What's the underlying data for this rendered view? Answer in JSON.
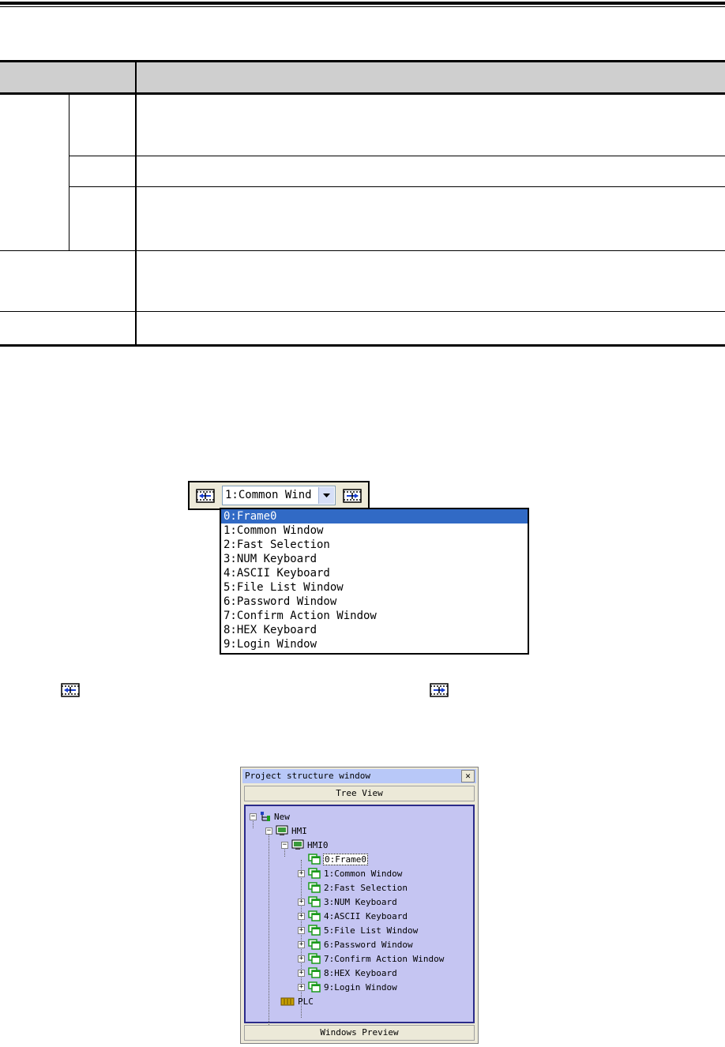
{
  "dropdown": {
    "selected": "1:Common Wind",
    "options": [
      "0:Frame0",
      "1:Common Window",
      "2:Fast Selection",
      "3:NUM Keyboard",
      "4:ASCII Keyboard",
      "5:File List Window",
      "6:Password Window",
      "7:Confirm Action Window",
      "8:HEX Keyboard",
      "9:Login Window"
    ],
    "prev_icon": "film-prev-icon",
    "next_icon": "film-next-icon"
  },
  "project_window": {
    "title": "Project structure window",
    "close": "✕",
    "tab_top": "Tree View",
    "tab_bottom": "Windows Preview",
    "tree": {
      "root": "New",
      "hmi": "HMI",
      "hmi0": "HMI0",
      "windows": [
        "0:Frame0",
        "1:Common Window",
        "2:Fast Selection",
        "3:NUM Keyboard",
        "4:ASCII Keyboard",
        "5:File List Window",
        "6:Password Window",
        "7:Confirm Action Window",
        "8:HEX Keyboard",
        "9:Login Window"
      ],
      "plc": "PLC"
    }
  },
  "colors": {
    "selection": "#316ac5",
    "tree_bg": "#c5c5f2",
    "title_bar": "#b8c8f8",
    "table_header": "#cfcfcf"
  }
}
